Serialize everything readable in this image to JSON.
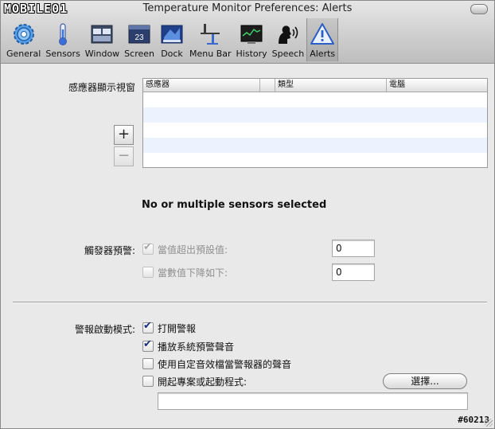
{
  "window": {
    "title": "Temperature Monitor Preferences: Alerts",
    "logo_text": "MOBILE01"
  },
  "toolbar": {
    "items": [
      {
        "label": "General",
        "icon": "gear-icon"
      },
      {
        "label": "Sensors",
        "icon": "thermometer-icon"
      },
      {
        "label": "Window",
        "icon": "window-icon"
      },
      {
        "label": "Screen",
        "icon": "screen-icon"
      },
      {
        "label": "Dock",
        "icon": "dock-icon"
      },
      {
        "label": "Menu Bar",
        "icon": "menubar-icon"
      },
      {
        "label": "History",
        "icon": "history-icon"
      },
      {
        "label": "Speech",
        "icon": "speech-icon"
      },
      {
        "label": "Alerts",
        "icon": "alert-icon"
      }
    ],
    "selected": "Alerts"
  },
  "sensors": {
    "label": "感應器顯示視窗",
    "columns": [
      "感應器",
      "",
      "類型",
      "電腦"
    ],
    "rows": [],
    "add_label": "+",
    "remove_label": "−"
  },
  "status": "No or multiple sensors selected",
  "triggers": {
    "label": "觸發器預警:",
    "above_label": "當值超出預設值:",
    "above_checked": true,
    "above_value": "0",
    "below_label": "當數值下降如下:",
    "below_checked": false,
    "below_value": "0"
  },
  "alert_mode": {
    "label": "警報啟動模式:",
    "options": [
      {
        "label": "打開警報",
        "checked": true
      },
      {
        "label": "播放系統預警聲音",
        "checked": true
      },
      {
        "label": "使用自定音效檔當警報器的聲音",
        "checked": false
      },
      {
        "label": "開起專案或起動程式:",
        "checked": false
      }
    ],
    "choose_label": "選擇...",
    "path_value": ""
  },
  "watermark": "#60213",
  "colors": {
    "accent": "#1b2f7e",
    "alt_row": "#edf3fe"
  }
}
